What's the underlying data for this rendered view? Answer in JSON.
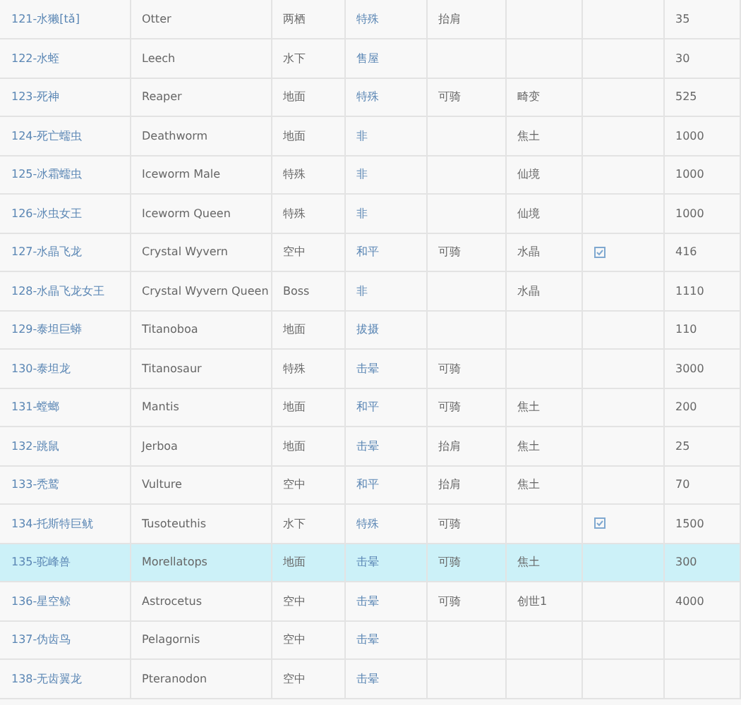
{
  "table": {
    "rows": [
      {
        "name": "121-水獭[tǎ]",
        "english": "Otter",
        "habitat": "两栖",
        "taming": "特殊",
        "ride": "抬肩",
        "value": "35",
        "selected": false,
        "checked": false
      },
      {
        "name": "122-水蛭",
        "english": "Leech",
        "habitat": "水下",
        "taming": "售屋",
        "value": "30",
        "selected": false,
        "checked": false
      },
      {
        "name": "123-死神",
        "english": "Reaper",
        "habitat": "地面",
        "taming": "特殊",
        "ride": "可骑",
        "map": "畸变",
        "value": "525",
        "selected": false,
        "checked": false
      },
      {
        "name": "124-死亡蠕虫",
        "english": "Deathworm",
        "habitat": "地面",
        "taming": "非",
        "map": "焦土",
        "value": "1000",
        "selected": false,
        "checked": false
      },
      {
        "name": "125-冰霜蠕虫",
        "english": "Iceworm Male",
        "habitat": "特殊",
        "taming": "非",
        "map": "仙境",
        "value": "1000",
        "selected": false,
        "checked": false
      },
      {
        "name": "126-冰虫女王",
        "english": "Iceworm Queen",
        "habitat": "特殊",
        "taming": "非",
        "map": "仙境",
        "value": "1000",
        "selected": false,
        "checked": false
      },
      {
        "name": "127-水晶飞龙",
        "english": "Crystal Wyvern",
        "habitat": "空中",
        "taming": "和平",
        "ride": "可骑",
        "map": "水晶",
        "value": "416",
        "selected": false,
        "checked": true
      },
      {
        "name": "128-水晶飞龙女王",
        "english": "Crystal Wyvern Queen",
        "habitat": "Boss",
        "taming": "非",
        "map": "水晶",
        "value": "1110",
        "selected": false,
        "checked": false
      },
      {
        "name": "129-泰坦巨蟒",
        "english": "Titanoboa",
        "habitat": "地面",
        "taming": "拔摄",
        "value": "110",
        "selected": false,
        "checked": false
      },
      {
        "name": "130-泰坦龙",
        "english": "Titanosaur",
        "habitat": "特殊",
        "taming": "击晕",
        "ride": "可骑",
        "value": "3000",
        "selected": false,
        "checked": false
      },
      {
        "name": "131-螳螂",
        "english": "Mantis",
        "habitat": "地面",
        "taming": "和平",
        "ride": "可骑",
        "map": "焦土",
        "value": "200",
        "selected": false,
        "checked": false
      },
      {
        "name": "132-跳鼠",
        "english": "Jerboa",
        "habitat": "地面",
        "taming": "击晕",
        "ride": "抬肩",
        "map": "焦土",
        "value": "25",
        "selected": false,
        "checked": false
      },
      {
        "name": "133-秃鹫",
        "english": "Vulture",
        "habitat": "空中",
        "taming": "和平",
        "ride": "抬肩",
        "map": "焦土",
        "value": "70",
        "selected": false,
        "checked": false
      },
      {
        "name": "134-托斯特巨鱿",
        "english": "Tusoteuthis",
        "habitat": "水下",
        "taming": "特殊",
        "ride": "可骑",
        "value": "1500",
        "selected": false,
        "checked": true
      },
      {
        "name": "135-驼峰兽",
        "english": "Morellatops",
        "habitat": "地面",
        "taming": "击晕",
        "ride": "可骑",
        "map": "焦土",
        "value": "300",
        "selected": true,
        "checked": false
      },
      {
        "name": "136-星空鲸",
        "english": "Astrocetus",
        "habitat": "空中",
        "taming": "击晕",
        "ride": "可骑",
        "map": "创世1",
        "value": "4000",
        "selected": false,
        "checked": false
      },
      {
        "name": "137-伪齿鸟",
        "english": "Pelagornis",
        "habitat": "空中",
        "taming": "击晕",
        "selected": false
      },
      {
        "name": "138-无齿翼龙",
        "english": "Pteranodon",
        "habitat": "空中",
        "taming": "击晕",
        "selected": false
      }
    ]
  }
}
